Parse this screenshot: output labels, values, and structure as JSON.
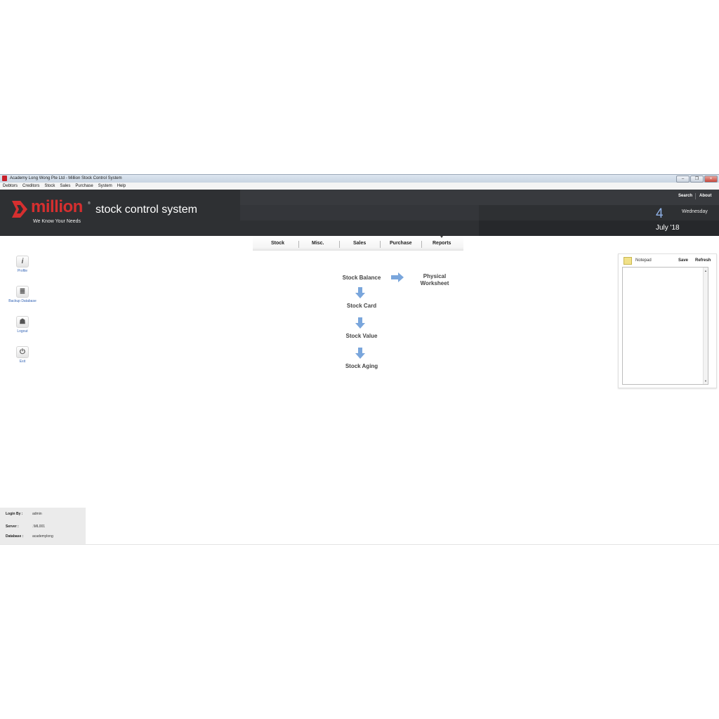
{
  "window": {
    "title": "Academy Long Wong Pte Ltd - Million Stock Control System",
    "controls": {
      "minimize": "–",
      "restore": "❐",
      "close": "×"
    }
  },
  "menu": [
    "Debtors",
    "Creditors",
    "Stock",
    "Sales",
    "Purchase",
    "System",
    "Help"
  ],
  "header": {
    "logo_word": "million",
    "logo_registered": "®",
    "system_name": "stock control system",
    "tagline": "We Know Your Needs",
    "links": {
      "search": "Search",
      "about": "About"
    },
    "date": {
      "day": "4",
      "weekday": "Wednesday",
      "month_year": "July '18"
    }
  },
  "tabs": [
    "Stock",
    "Misc.",
    "Sales",
    "Purchase",
    "Reports"
  ],
  "sidebar": [
    {
      "label": "Profile",
      "icon": "info-icon",
      "glyph": "i"
    },
    {
      "label": "Backup Database",
      "icon": "database-icon",
      "glyph": "≣"
    },
    {
      "label": "Logout",
      "icon": "user-icon",
      "glyph": "☗"
    },
    {
      "label": "Exit",
      "icon": "power-icon",
      "glyph": "⏻"
    }
  ],
  "flow": {
    "stock_balance": "Stock Balance",
    "physical_worksheet_line1": "Physical",
    "physical_worksheet_line2": "Worksheet",
    "stock_card": "Stock Card",
    "stock_value": "Stock Value",
    "stock_aging": "Stock Aging"
  },
  "notepad": {
    "title": "Notepad",
    "save": "Save",
    "refresh": "Refresh",
    "content": ""
  },
  "status": {
    "login_label": "Login By :",
    "login_value": "admin",
    "server_label": "Server :",
    "server_value": ".\\ML001",
    "database_label": "Database :",
    "database_value": "academylong"
  },
  "colors": {
    "brand_red": "#d62f2f",
    "header_dark": "#2e3033",
    "date_blue": "#8fb0e6",
    "link_blue": "#3565b5",
    "arrow_blue": "#7aa6dc"
  }
}
